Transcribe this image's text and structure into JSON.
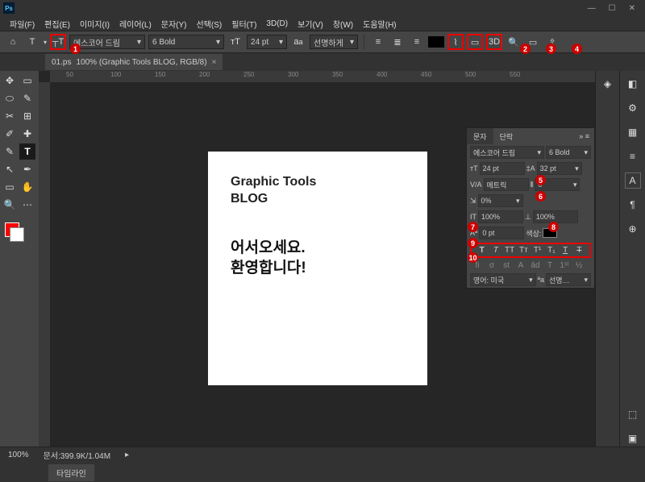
{
  "menus": [
    "파일(F)",
    "편집(E)",
    "이미지(I)",
    "레이어(L)",
    "문자(Y)",
    "선택(S)",
    "필터(T)",
    "3D(D)",
    "보기(V)",
    "창(W)",
    "도움말(H)"
  ],
  "opt": {
    "font": "에스코어 드림",
    "weight": "6 Bold",
    "size": "24 pt",
    "aa": "선명하게",
    "threeD": "3D"
  },
  "tab": {
    "name": "01.ps",
    "rest": "100% (Graphic Tools BLOG, RGB/8)"
  },
  "ruler": [
    "50",
    "100",
    "150",
    "200",
    "250",
    "300",
    "350",
    "400",
    "450",
    "500",
    "550"
  ],
  "canvas": {
    "title1": "Graphic Tools",
    "title2": "BLOG",
    "body1": "어서오세요.",
    "body2": "환영합니다!"
  },
  "charPanel": {
    "tab1": "문자",
    "tab2": "단락",
    "font": "에스코어 드림",
    "weight": "6 Bold",
    "size": "24 pt",
    "leading": "32 pt",
    "kerning": "메트릭",
    "tracking": "0",
    "scale": "0%",
    "hscale": "100%",
    "vscale": "100%",
    "baseline": "0 pt",
    "colorLabel": "색상:",
    "lang": "영어: 미국",
    "aa": "선명…"
  },
  "status": {
    "zoom": "100%",
    "doc": "문서:399.9K/1.04M"
  },
  "timeline": "타임라인",
  "badges": [
    "1",
    "2",
    "3",
    "4",
    "5",
    "6",
    "7",
    "8",
    "9",
    "10"
  ]
}
